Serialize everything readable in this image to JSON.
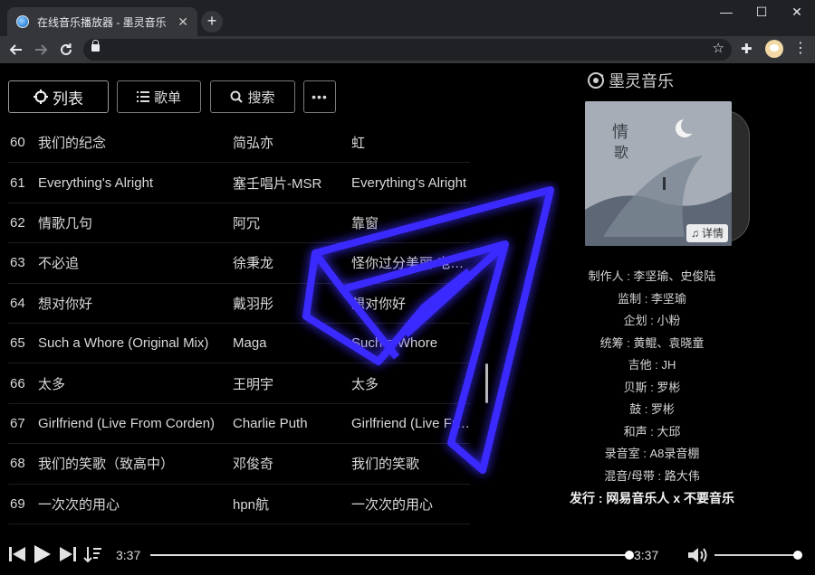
{
  "browser": {
    "tab_title": "在线音乐播放器 - 墨灵音乐",
    "tab_close": "✕",
    "new_tab": "+",
    "window_controls": [
      "—",
      "☐",
      "✕"
    ]
  },
  "app": {
    "brand": "墨灵音乐",
    "buttons": {
      "list": "列表",
      "songlist": "歌单",
      "search": "搜索",
      "more": "•••"
    },
    "songs": [
      {
        "num": "60",
        "title": "我们的纪念",
        "artist": "简弘亦",
        "album": "虹"
      },
      {
        "num": "61",
        "title": "Everything's Alright",
        "artist": "塞壬唱片-MSR",
        "album": "Everything's Alright"
      },
      {
        "num": "62",
        "title": "情歌几句",
        "artist": "阿冗",
        "album": "靠窗"
      },
      {
        "num": "63",
        "title": "不必追",
        "artist": "徐秉龙",
        "album": "怪你过分美丽 电影原声"
      },
      {
        "num": "64",
        "title": "想对你好",
        "artist": "戴羽彤",
        "album": "想对你好"
      },
      {
        "num": "65",
        "title": "Such a Whore (Original Mix)",
        "artist": "Maga",
        "album": "Such a Whore"
      },
      {
        "num": "66",
        "title": "太多",
        "artist": "王明宇",
        "album": "太多"
      },
      {
        "num": "67",
        "title": "Girlfriend (Live From Corden)",
        "artist": "Charlie Puth",
        "album": "Girlfriend (Live From Corden)"
      },
      {
        "num": "68",
        "title": "我们的笑歌（致高中）",
        "artist": "邓俊奇",
        "album": "我们的笑歌"
      },
      {
        "num": "69",
        "title": "一次次的用心",
        "artist": "hpn航",
        "album": "一次次的用心"
      }
    ],
    "cover_detail": "详情",
    "credits": [
      "制作人 : 李坚瑜、史俊陆",
      "监制 : 李坚瑜",
      "企划 : 小粉",
      "统筹 : 黄鲲、袁晓童",
      "吉他 : JH",
      "贝斯 : 罗彬",
      "鼓 : 罗彬",
      "和声 : 大邱",
      "录音室 : A8录音棚",
      "混音/母带 : 路大伟"
    ],
    "release": "发行 : 网易音乐人 x 不要音乐",
    "player": {
      "current_time": "3:37",
      "total_time": "3:37",
      "progress": 0.99,
      "volume": 0.92
    }
  }
}
